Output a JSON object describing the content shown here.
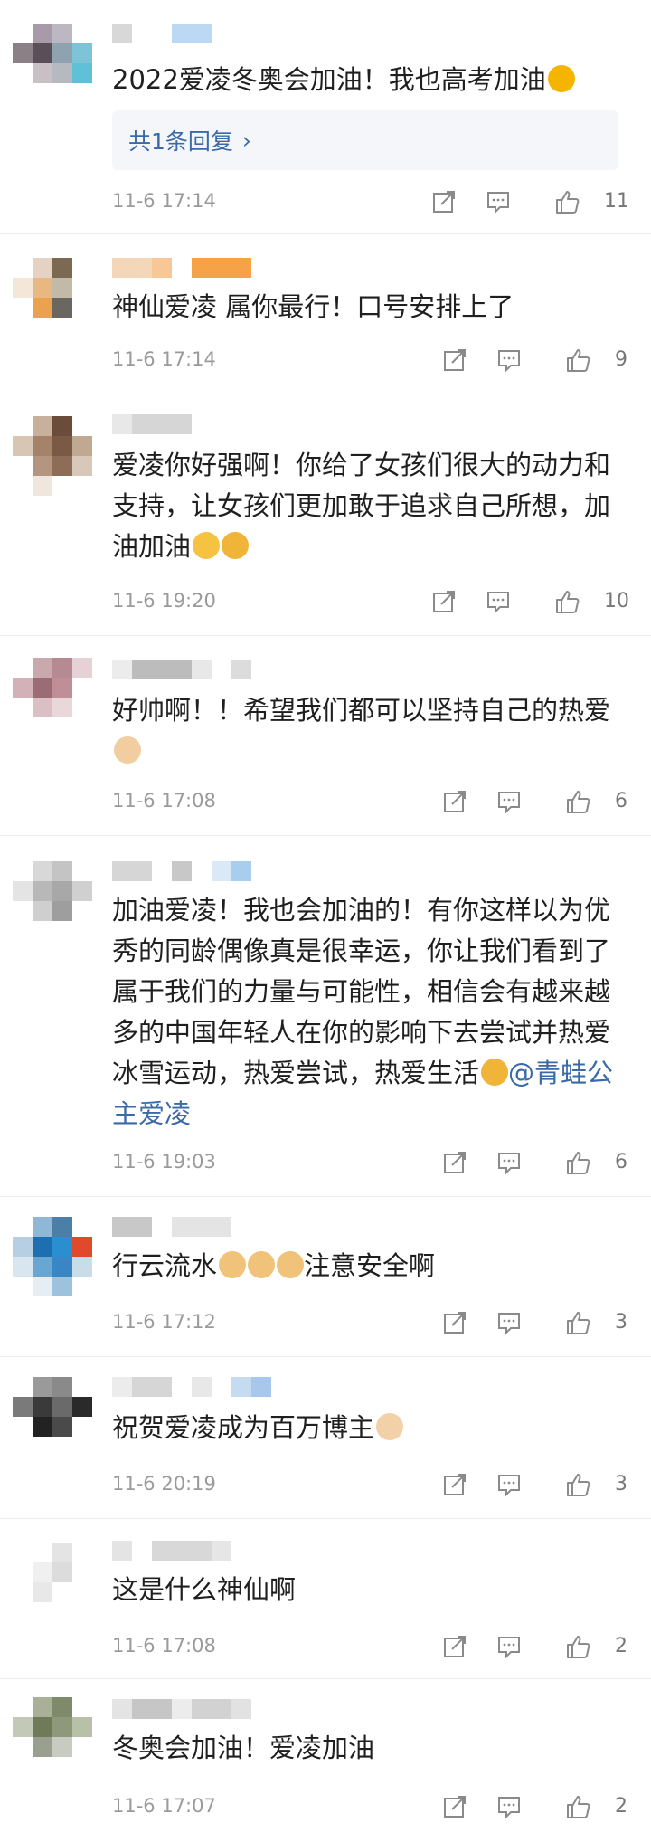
{
  "colors": {
    "link": "#3a6aa8",
    "time": "#9a9a9a",
    "icon": "#8a8a8a"
  },
  "icons": {
    "share": "share-icon",
    "comment": "comment-icon",
    "like": "thumbs-up-icon"
  },
  "comments": [
    {
      "text": "2022爱凌冬奥会加油！我也高考加油",
      "emojis": [
        "flexed-biceps"
      ],
      "replies_label": "共1条回复",
      "time": "11-6 17:14",
      "likes": "11"
    },
    {
      "text": "神仙爱凌 属你最行！口号安排上了",
      "emojis": [],
      "time": "11-6 17:14",
      "likes": "9"
    },
    {
      "text": "爱凌你好强啊！你给了女孩们很大的动力和支持，让女孩们更加敢于追求自己所想，加油加油",
      "emojis": [
        "tears-of-joy",
        "screaming-face"
      ],
      "time": "11-6 19:20",
      "likes": "10"
    },
    {
      "text": "好帅啊！！希望我们都可以坚持自己的热爱",
      "emojis": [
        "flexed-biceps"
      ],
      "time": "11-6 17:08",
      "likes": "6"
    },
    {
      "text": "加油爱凌！我也会加油的！有你这样以为优秀的同龄偶像真是很幸运，你让我们看到了属于我们的力量与可能性，相信会有越来越多的中国年轻人在你的影响下去尝试并热爱冰雪运动，热爱尝试，热爱生活",
      "emojis": [
        "screaming-face"
      ],
      "mention": "@青蛙公主爱凌",
      "time": "11-6 19:03",
      "likes": "6"
    },
    {
      "text": "行云流水",
      "emojis": [
        "thumbs-up",
        "thumbs-up",
        "thumbs-up"
      ],
      "text_after": "注意安全啊",
      "time": "11-6 17:12",
      "likes": "3"
    },
    {
      "text": "祝贺爱凌成为百万博主",
      "emojis": [
        "clapping-hands"
      ],
      "time": "11-6 20:19",
      "likes": "3"
    },
    {
      "text": "这是什么神仙啊",
      "emojis": [],
      "time": "11-6 17:08",
      "likes": "2"
    },
    {
      "text": "冬奥会加油！爱凌加油",
      "emojis": [],
      "time": "11-6 17:07",
      "likes": "2"
    }
  ]
}
